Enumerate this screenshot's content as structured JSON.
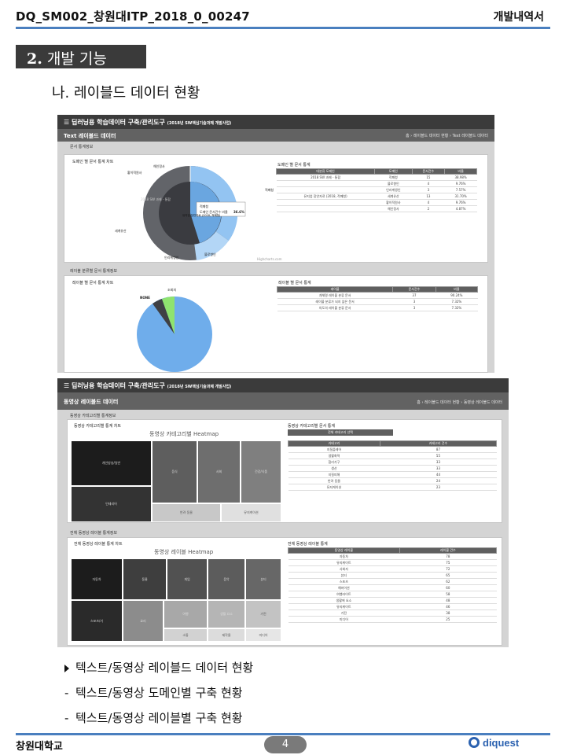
{
  "header": {
    "doc_id": "DQ_SM002_창원대ITP_2018_0_00247",
    "doc_type": "개발내역서"
  },
  "section": {
    "number": "2.",
    "title": "개발 기능"
  },
  "subsection": "나. 레이블드 데이터 현황",
  "shot1": {
    "app_title": "☰ 딥러닝용 학습데이터 구축/관리도구",
    "app_subtitle": "(2018년 SW핵심기술과제 개발사업)",
    "page_title": "Text 레이블드 데이터",
    "breadcrumb": "홈 › 레이블드 데이터 현황 › Text 레이블드 데이터",
    "section1_label": "문서 통계정보",
    "panel1_title": "도메인 별 문서 통계 차트",
    "panel2_title": "도메인 별 문서 통계",
    "table1": {
      "headers": [
        "대분류 도메인",
        "도메인",
        "문서건수",
        "비율"
      ],
      "rows": [
        [
          "2018 SW 과제 - 통합",
          "적폐청",
          "15",
          "38.98%"
        ],
        [
          "",
          "블로향인",
          "4",
          "9.76%"
        ],
        [
          "",
          "인리케앵인",
          "3",
          "7.57%"
        ],
        [
          "뮤지엄 장안자료 (2018, 적폐청)",
          "세계유산",
          "13",
          "31.70%"
        ],
        [
          "",
          "황이적원사",
          "4",
          "9.76%"
        ],
        [
          "",
          "해인정사",
          "2",
          "4.87%"
        ]
      ]
    },
    "donut_labels": [
      "적폐청",
      "블로향인",
      "인리케앵인",
      "세계유산",
      "황이적원사",
      "해인정사"
    ],
    "donut_tooltip": {
      "line1": "적폐청",
      "line2": "도메인 문서건수 비율",
      "value": "36.6%"
    },
    "inner_label_left": "2018 SW 과제 - 통합",
    "inner_label_right": "뮤지엄 장안자료 (2018, 적폐청)",
    "section2_label": "레이블 분류별 문서 통계정보",
    "panel3_title": "레이블 별 문서 통계 차트",
    "panel4_title": "레이블 별 문서 통계",
    "pie_labels": [
      "NONE",
      "조회처"
    ],
    "table2": {
      "headers": [
        "레이블",
        "문서건수",
        "비율"
      ],
      "rows": [
        [
          "개체명 레이블 분류 문서",
          "37",
          "90.24%"
        ],
        [
          "레이블 분류가 되지 않은 문서",
          "3",
          "7.32%"
        ],
        [
          "의도의 레이블 분류 문서",
          "3",
          "7.32%"
        ]
      ]
    },
    "watermark": "Highcharts.com"
  },
  "shot2": {
    "app_title": "☰ 딥러닝용 학습데이터 구축/관리도구",
    "app_subtitle": "(2018년 SW핵심기술과제 개발사업)",
    "page_title": "동영상 레이블드 데이터",
    "breadcrumb": "홈 › 레이블드 데이터 현황 › 동영상 레이블드 데이터",
    "section1_label": "동영상 카테고리별 통계정보",
    "panel1_title": "동영상 카테고리별 통계 차트",
    "heatmap1_title": "동영상 카테고리별 Heatmap",
    "heatmap1_cells": [
      "개인방송/일반",
      "인테리어",
      "음식",
      "사회",
      "건강/식품",
      "반려 동물",
      "뮤지케이션"
    ],
    "panel2_title": "동영상 카테고리별 문서 통계",
    "total_button": "전체 카테고리 선택",
    "table3": {
      "headers": [
        "카테고리",
        "카테고리 건수"
      ],
      "rows": [
        [
          "지질플레어",
          "87"
        ],
        [
          "생활화력",
          "55"
        ],
        [
          "합리가구",
          "33"
        ],
        [
          "생산",
          "33"
        ],
        [
          "지질피해",
          "44"
        ],
        [
          "반려 동물",
          "24"
        ],
        [
          "뮤지케이션",
          "23"
        ]
      ]
    },
    "section2_label": "전체 동영상 레이블 통계정보",
    "panel3_title": "전체 동영상 레이블 통계 차트",
    "heatmap2_title": "동영상 레이블 Heatmap",
    "heatmap2_cells": [
      "자동차",
      "스포츠/기",
      "동물",
      "게임",
      "음악",
      "뷰티",
      "요리",
      "여행",
      "생활 요소",
      "가전",
      "소통",
      "제작물",
      "미디어"
    ],
    "panel4_title": "전체 동영상 레이블 통계",
    "table4": {
      "headers": [
        "동영상 레이블",
        "레이블 건수"
      ],
      "rows": [
        [
          "자동차",
          "78"
        ],
        [
          "뮤지케이트",
          "75"
        ],
        [
          "사회자",
          "72"
        ],
        [
          "뷰티",
          "65"
        ],
        [
          "스포츠",
          "62"
        ],
        [
          "해마이션",
          "60"
        ],
        [
          "여행라이트",
          "58"
        ],
        [
          "생활에 요소",
          "48"
        ],
        [
          "뮤지케이트",
          "46"
        ],
        [
          "가전",
          "38"
        ],
        [
          "미디어",
          "25"
        ]
      ]
    },
    "watermark": "Highcharts.com"
  },
  "bullets": [
    "텍스트/동영상 레이블드 데이터 현황",
    "텍스트/동영상 도메인별 구축 현황",
    "텍스트/동영상 레이블별 구축 현황"
  ],
  "footer": {
    "university": "창원대학교",
    "page": "4",
    "logo": "diquest"
  }
}
